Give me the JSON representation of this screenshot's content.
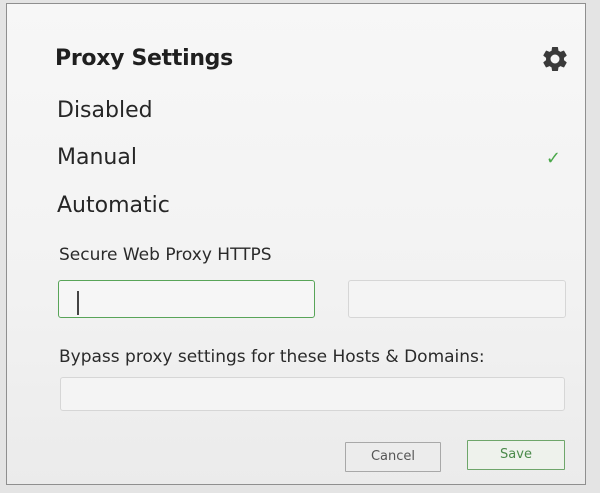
{
  "dialog": {
    "title": "Proxy Settings",
    "settings_icon": "gear-icon"
  },
  "proxy_modes": [
    {
      "label": "Disabled",
      "selected": false
    },
    {
      "label": "Manual",
      "selected": true
    },
    {
      "label": "Automatic",
      "selected": false
    }
  ],
  "selected_indicator": "check-icon",
  "secure_proxy": {
    "label": "Secure Web Proxy HTTPS",
    "host_value": "",
    "port_value": ""
  },
  "bypass": {
    "label": "Bypass proxy settings for these Hosts & Domains:",
    "value": ""
  },
  "buttons": {
    "cancel": "Cancel",
    "save": "Save"
  },
  "colors": {
    "accent": "#58a458",
    "check": "#4aa84a",
    "panel": "#f4f4f4",
    "border": "#8f8f8f"
  }
}
